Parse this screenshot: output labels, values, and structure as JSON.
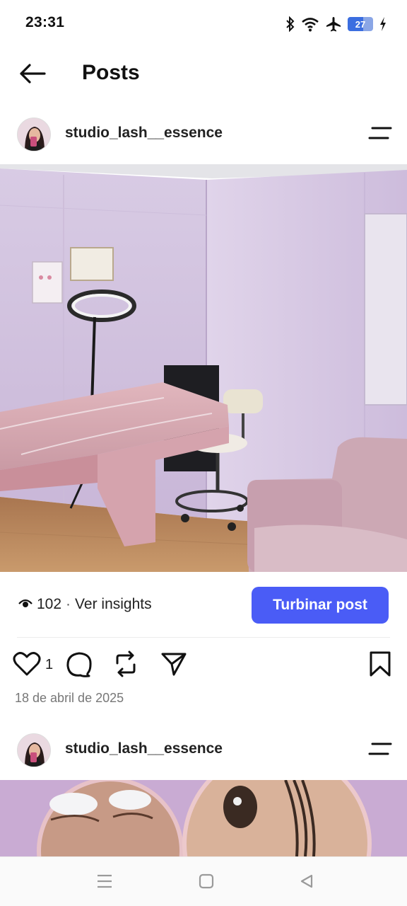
{
  "status_bar": {
    "time": "23:31",
    "battery_level": "27",
    "icons": [
      "bluetooth-icon",
      "wifi-icon",
      "airplane-icon",
      "battery-icon",
      "charging-icon"
    ]
  },
  "header": {
    "title": "Posts",
    "back_icon": "arrow-left-icon"
  },
  "posts": [
    {
      "username": "studio_lash__essence",
      "menu_icon": "menu-lines-icon",
      "image_description_icon": "photo",
      "views": "102",
      "views_separator": "·",
      "insights_label": "Ver insights",
      "boost_label": "Turbinar post",
      "like_count": "1",
      "date": "18 de abril de 2025"
    },
    {
      "username": "studio_lash__essence",
      "menu_icon": "menu-lines-icon"
    }
  ],
  "nav_bar": {
    "buttons": [
      "menu-icon",
      "home-square-icon",
      "back-triangle-icon"
    ]
  },
  "colors": {
    "accent": "#4a5cf6",
    "wall": "#d9c9e3",
    "floor": "#b9865a",
    "upholstery": "#d9a9b3"
  }
}
